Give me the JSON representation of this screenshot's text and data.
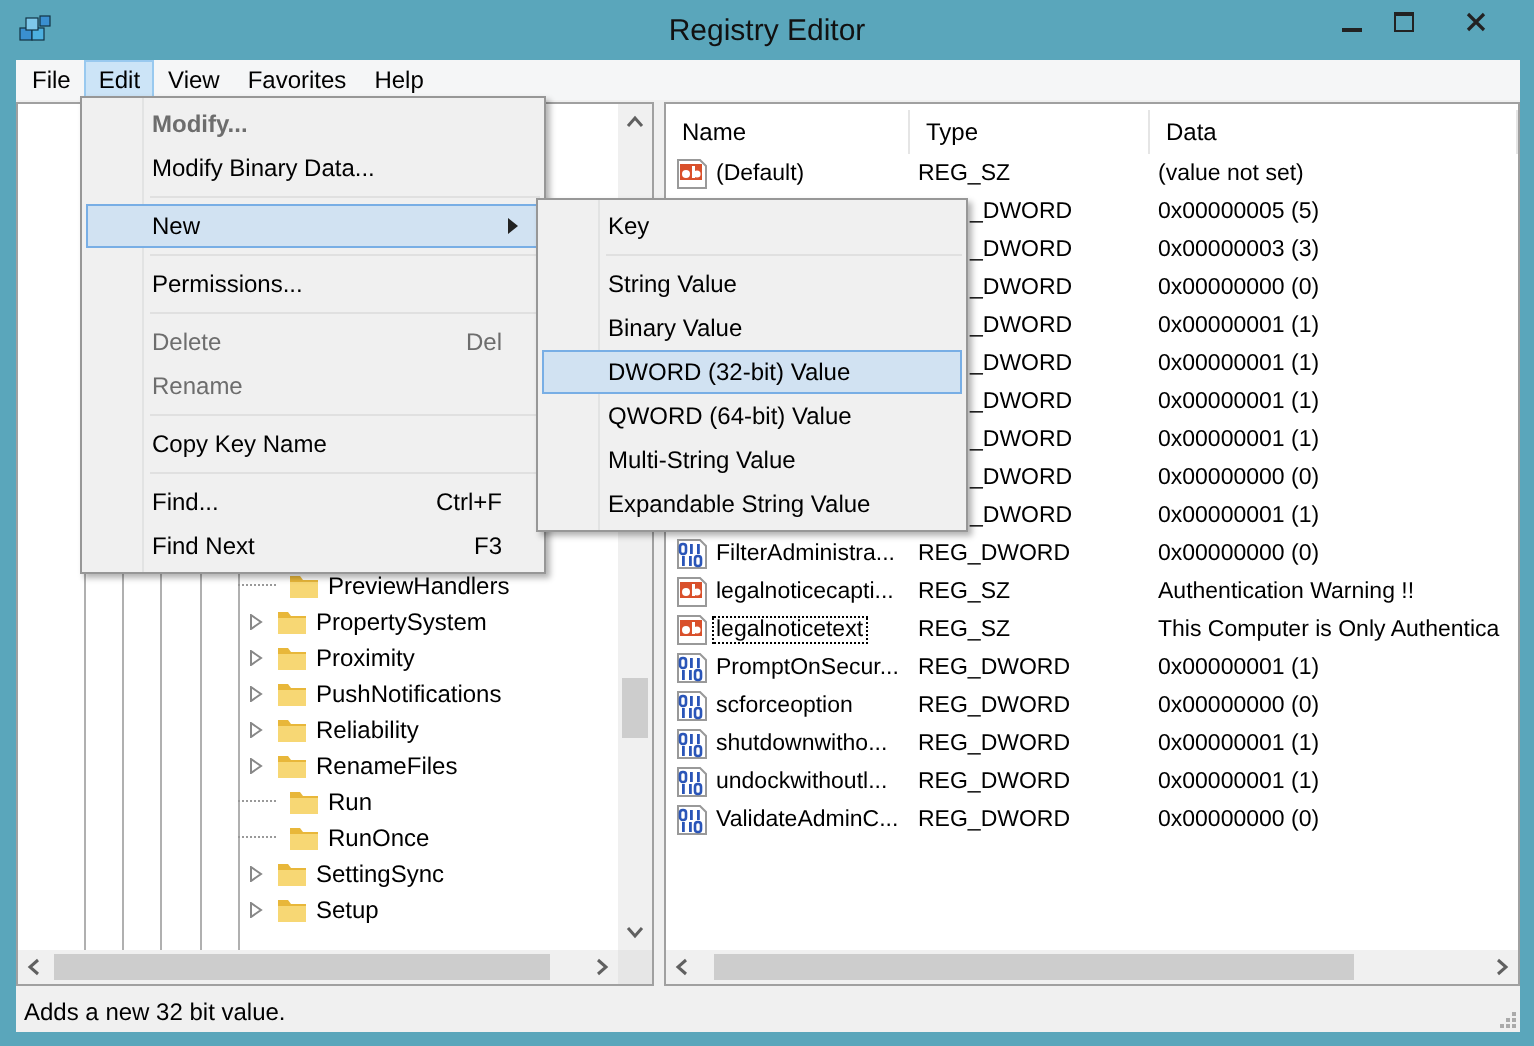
{
  "window": {
    "title": "Registry Editor"
  },
  "menu_bar": [
    {
      "label": "File",
      "selected": false
    },
    {
      "label": "Edit",
      "selected": true
    },
    {
      "label": "View",
      "selected": false
    },
    {
      "label": "Favorites",
      "selected": false
    },
    {
      "label": "Help",
      "selected": false
    }
  ],
  "edit_menu": [
    {
      "kind": "item",
      "label": "Modify...",
      "disabled": true,
      "default": true,
      "selected": false,
      "submenu": false
    },
    {
      "kind": "item",
      "label": "Modify Binary Data...",
      "disabled": false,
      "default": false,
      "selected": false,
      "submenu": false
    },
    {
      "kind": "separator"
    },
    {
      "kind": "item",
      "label": "New",
      "disabled": false,
      "default": false,
      "selected": true,
      "submenu": true
    },
    {
      "kind": "separator"
    },
    {
      "kind": "item",
      "label": "Permissions...",
      "disabled": false,
      "default": false,
      "selected": false,
      "submenu": false
    },
    {
      "kind": "separator"
    },
    {
      "kind": "item",
      "label": "Delete",
      "shortcut": "Del",
      "disabled": true,
      "default": false,
      "selected": false,
      "submenu": false
    },
    {
      "kind": "item",
      "label": "Rename",
      "disabled": true,
      "default": false,
      "selected": false,
      "submenu": false
    },
    {
      "kind": "separator"
    },
    {
      "kind": "item",
      "label": "Copy Key Name",
      "disabled": false,
      "default": false,
      "selected": false,
      "submenu": false
    },
    {
      "kind": "separator"
    },
    {
      "kind": "item",
      "label": "Find...",
      "shortcut": "Ctrl+F",
      "disabled": false,
      "default": false,
      "selected": false,
      "submenu": false
    },
    {
      "kind": "item",
      "label": "Find Next",
      "shortcut": "F3",
      "disabled": false,
      "default": false,
      "selected": false,
      "submenu": false
    }
  ],
  "new_submenu": [
    {
      "kind": "item",
      "label": "Key",
      "selected": false
    },
    {
      "kind": "separator"
    },
    {
      "kind": "item",
      "label": "String Value",
      "selected": false
    },
    {
      "kind": "item",
      "label": "Binary Value",
      "selected": false
    },
    {
      "kind": "item",
      "label": "DWORD (32-bit) Value",
      "selected": true
    },
    {
      "kind": "item",
      "label": "QWORD (64-bit) Value",
      "selected": false
    },
    {
      "kind": "item",
      "label": "Multi-String Value",
      "selected": false
    },
    {
      "kind": "item",
      "label": "Expandable String Value",
      "selected": false
    }
  ],
  "tree": {
    "items": [
      {
        "label": "PreviewHandlers",
        "expandable": false
      },
      {
        "label": "PropertySystem",
        "expandable": true
      },
      {
        "label": "Proximity",
        "expandable": true
      },
      {
        "label": "PushNotifications",
        "expandable": true
      },
      {
        "label": "Reliability",
        "expandable": true
      },
      {
        "label": "RenameFiles",
        "expandable": true
      },
      {
        "label": "Run",
        "expandable": false
      },
      {
        "label": "RunOnce",
        "expandable": false
      },
      {
        "label": "SettingSync",
        "expandable": true
      },
      {
        "label": "Setup",
        "expandable": true
      }
    ]
  },
  "values": {
    "columns": [
      "Name",
      "Type",
      "Data"
    ],
    "rows": [
      {
        "kind": "string",
        "name": "(Default)",
        "type": "REG_SZ",
        "data": "(value not set)",
        "focused": false
      },
      {
        "kind": "covered",
        "type": "_DWORD",
        "data": "0x00000005 (5)"
      },
      {
        "kind": "covered",
        "type": "_DWORD",
        "data": "0x00000003 (3)"
      },
      {
        "kind": "covered",
        "type": "_DWORD",
        "data": "0x00000000 (0)"
      },
      {
        "kind": "covered",
        "type": "_DWORD",
        "data": "0x00000001 (1)"
      },
      {
        "kind": "covered",
        "type": "_DWORD",
        "data": "0x00000001 (1)"
      },
      {
        "kind": "covered",
        "type": "_DWORD",
        "data": "0x00000001 (1)"
      },
      {
        "kind": "covered",
        "type": "_DWORD",
        "data": "0x00000001 (1)"
      },
      {
        "kind": "covered",
        "type": "_DWORD",
        "data": "0x00000000 (0)"
      },
      {
        "kind": "covered",
        "type": "_DWORD",
        "data": "0x00000001 (1)"
      },
      {
        "kind": "number",
        "name": "FilterAdministra...",
        "type": "REG_DWORD",
        "data": "0x00000000 (0)",
        "focused": false
      },
      {
        "kind": "string",
        "name": "legalnoticecapti...",
        "type": "REG_SZ",
        "data": "Authentication Warning !!",
        "focused": false
      },
      {
        "kind": "string",
        "name": "legalnoticetext",
        "type": "REG_SZ",
        "data": "This Computer is Only Authentica",
        "focused": true
      },
      {
        "kind": "number",
        "name": "PromptOnSecur...",
        "type": "REG_DWORD",
        "data": "0x00000001 (1)",
        "focused": false
      },
      {
        "kind": "number",
        "name": "scforceoption",
        "type": "REG_DWORD",
        "data": "0x00000000 (0)",
        "focused": false
      },
      {
        "kind": "number",
        "name": "shutdownwitho...",
        "type": "REG_DWORD",
        "data": "0x00000001 (1)",
        "focused": false
      },
      {
        "kind": "number",
        "name": "undockwithoutl...",
        "type": "REG_DWORD",
        "data": "0x00000001 (1)",
        "focused": false
      },
      {
        "kind": "number",
        "name": "ValidateAdminC...",
        "type": "REG_DWORD",
        "data": "0x00000000 (0)",
        "focused": false
      }
    ]
  },
  "status_bar": "Adds a new 32 bit value."
}
